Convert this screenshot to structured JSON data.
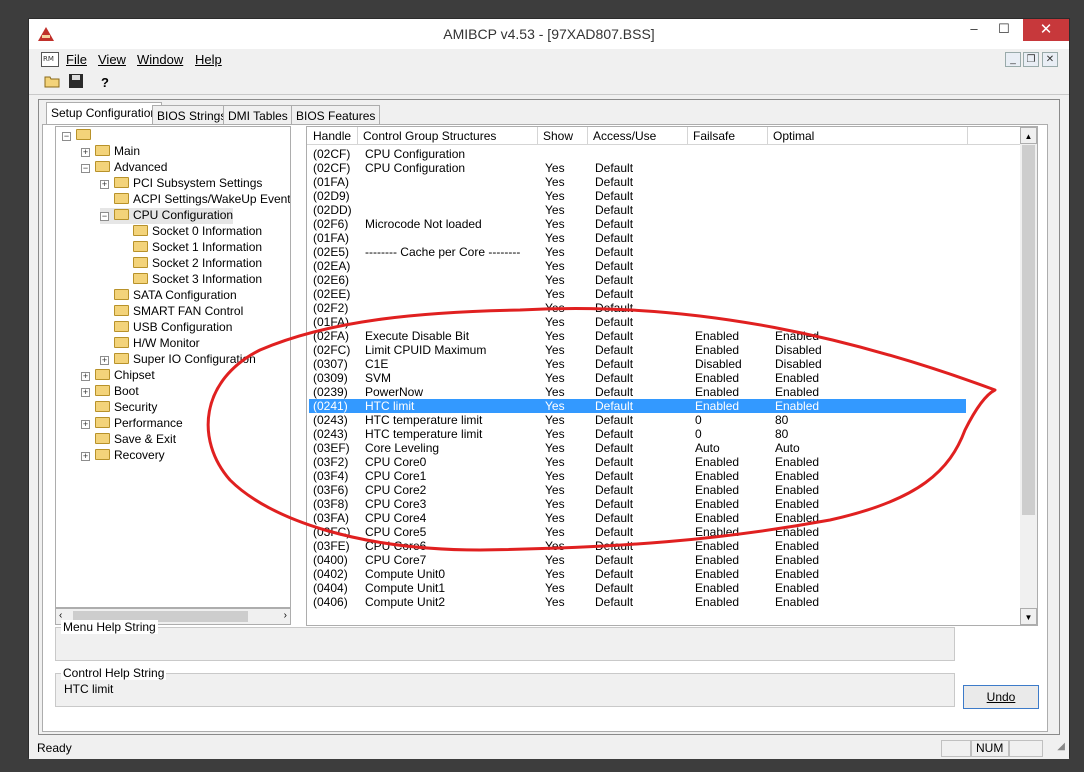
{
  "window": {
    "title": "AMIBCP v4.53 - [97XAD807.BSS]",
    "minimize": "–",
    "maximize": "☐",
    "close": "✕"
  },
  "menu": {
    "items": [
      {
        "label": "File"
      },
      {
        "label": "View"
      },
      {
        "label": "Window"
      },
      {
        "label": "Help"
      }
    ],
    "mdi_min": "_",
    "mdi_restore": "❐",
    "mdi_close": "✕"
  },
  "tabs": [
    {
      "label": "Setup Configuration"
    },
    {
      "label": "BIOS Strings"
    },
    {
      "label": "DMI Tables"
    },
    {
      "label": "BIOS Features"
    }
  ],
  "tree": {
    "items": [
      {
        "label": "",
        "indent": 0,
        "expander": "−"
      },
      {
        "label": "Main",
        "indent": 1,
        "expander": "+"
      },
      {
        "label": "Advanced",
        "indent": 1,
        "expander": "−"
      },
      {
        "label": "PCI Subsystem Settings",
        "indent": 2,
        "expander": "+"
      },
      {
        "label": "ACPI Settings/WakeUp Event co",
        "indent": 2,
        "expander": ""
      },
      {
        "label": "CPU Configuration",
        "indent": 2,
        "expander": "−"
      },
      {
        "label": "Socket 0 Information",
        "indent": 3,
        "expander": ""
      },
      {
        "label": "Socket 1 Information",
        "indent": 3,
        "expander": ""
      },
      {
        "label": "Socket 2 Information",
        "indent": 3,
        "expander": ""
      },
      {
        "label": "Socket 3 Information",
        "indent": 3,
        "expander": ""
      },
      {
        "label": "SATA Configuration",
        "indent": 2,
        "expander": ""
      },
      {
        "label": "SMART FAN Control",
        "indent": 2,
        "expander": ""
      },
      {
        "label": "USB Configuration",
        "indent": 2,
        "expander": ""
      },
      {
        "label": "H/W Monitor",
        "indent": 2,
        "expander": ""
      },
      {
        "label": "Super IO Configuration",
        "indent": 2,
        "expander": "+"
      },
      {
        "label": "Chipset",
        "indent": 1,
        "expander": "+"
      },
      {
        "label": "Boot",
        "indent": 1,
        "expander": "+"
      },
      {
        "label": "Security",
        "indent": 1,
        "expander": ""
      },
      {
        "label": "Performance",
        "indent": 1,
        "expander": "+"
      },
      {
        "label": "Save & Exit",
        "indent": 1,
        "expander": ""
      },
      {
        "label": "Recovery",
        "indent": 1,
        "expander": "+"
      }
    ]
  },
  "grid": {
    "columns": [
      "Handle",
      "Control Group Structures",
      "Show",
      "Access/Use",
      "Failsafe",
      "Optimal"
    ],
    "rows": [
      [
        "(02CF)",
        "CPU Configuration",
        "",
        "",
        "",
        ""
      ],
      [
        "(02CF)",
        "CPU Configuration",
        "Yes",
        "Default",
        "",
        ""
      ],
      [
        "(01FA)",
        "",
        "Yes",
        "Default",
        "",
        ""
      ],
      [
        "(02D9)",
        "",
        "Yes",
        "Default",
        "",
        ""
      ],
      [
        "(02DD)",
        "",
        "Yes",
        "Default",
        "",
        ""
      ],
      [
        "(02F6)",
        "Microcode Not loaded",
        "Yes",
        "Default",
        "",
        ""
      ],
      [
        "(01FA)",
        "",
        "Yes",
        "Default",
        "",
        ""
      ],
      [
        "(02E5)",
        "-------- Cache per Core --------",
        "Yes",
        "Default",
        "",
        ""
      ],
      [
        "(02EA)",
        "",
        "Yes",
        "Default",
        "",
        ""
      ],
      [
        "(02E6)",
        "",
        "Yes",
        "Default",
        "",
        ""
      ],
      [
        "(02EE)",
        "",
        "Yes",
        "Default",
        "",
        ""
      ],
      [
        "(02F2)",
        "",
        "Yes",
        "Default",
        "",
        ""
      ],
      [
        "(01FA)",
        "",
        "Yes",
        "Default",
        "",
        ""
      ],
      [
        "(02FA)",
        "Execute Disable Bit",
        "Yes",
        "Default",
        "Enabled",
        "Enabled"
      ],
      [
        "(02FC)",
        "Limit CPUID Maximum",
        "Yes",
        "Default",
        "Enabled",
        "Disabled"
      ],
      [
        "(0307)",
        "C1E",
        "Yes",
        "Default",
        "Disabled",
        "Disabled"
      ],
      [
        "(0309)",
        "SVM",
        "Yes",
        "Default",
        "Enabled",
        "Enabled"
      ],
      [
        "(0239)",
        "PowerNow",
        "Yes",
        "Default",
        "Enabled",
        "Enabled"
      ],
      [
        "(0241)",
        "HTC limit",
        "Yes",
        "Default",
        "Enabled",
        "Enabled"
      ],
      [
        "(0243)",
        "HTC temperature limit",
        "Yes",
        "Default",
        "0",
        "80"
      ],
      [
        "(0243)",
        "HTC temperature limit",
        "Yes",
        "Default",
        "0",
        "80"
      ],
      [
        "(03EF)",
        "Core Leveling",
        "Yes",
        "Default",
        "Auto",
        "Auto"
      ],
      [
        "(03F2)",
        "CPU Core0",
        "Yes",
        "Default",
        "Enabled",
        "Enabled"
      ],
      [
        "(03F4)",
        "CPU Core1",
        "Yes",
        "Default",
        "Enabled",
        "Enabled"
      ],
      [
        "(03F6)",
        "CPU Core2",
        "Yes",
        "Default",
        "Enabled",
        "Enabled"
      ],
      [
        "(03F8)",
        "CPU Core3",
        "Yes",
        "Default",
        "Enabled",
        "Enabled"
      ],
      [
        "(03FA)",
        "CPU Core4",
        "Yes",
        "Default",
        "Enabled",
        "Enabled"
      ],
      [
        "(03FC)",
        "CPU Core5",
        "Yes",
        "Default",
        "Enabled",
        "Enabled"
      ],
      [
        "(03FE)",
        "CPU Core6",
        "Yes",
        "Default",
        "Enabled",
        "Enabled"
      ],
      [
        "(0400)",
        "CPU Core7",
        "Yes",
        "Default",
        "Enabled",
        "Enabled"
      ],
      [
        "(0402)",
        "Compute Unit0",
        "Yes",
        "Default",
        "Enabled",
        "Enabled"
      ],
      [
        "(0404)",
        "Compute Unit1",
        "Yes",
        "Default",
        "Enabled",
        "Enabled"
      ],
      [
        "(0406)",
        "Compute Unit2",
        "Yes",
        "Default",
        "Enabled",
        "Enabled"
      ]
    ],
    "selected_index": 18
  },
  "menu_help": {
    "label": "Menu Help String",
    "text": ""
  },
  "control_help": {
    "label": "Control Help String",
    "text": "HTC limit"
  },
  "undo_label": "Undo",
  "status": {
    "text": "Ready",
    "num": "NUM"
  },
  "colors": {
    "selection": "#3399ff",
    "annotation": "#e02020",
    "close": "#c7383b"
  }
}
